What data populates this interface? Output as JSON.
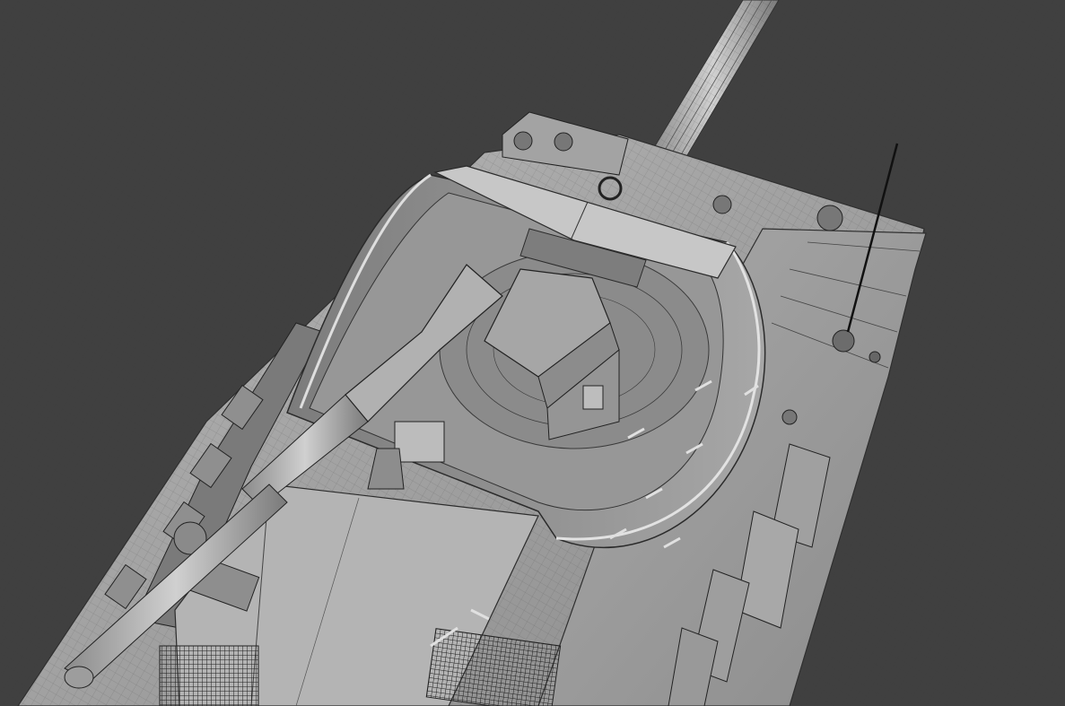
{
  "scene": {
    "subject": "tank-wireframe-render",
    "background_color": "#404040",
    "hull_color": "#9a9a9a",
    "hull_shadow_color": "#6e6e6e",
    "hull_highlight_color": "#c9c9c9",
    "wire_color": "#2e2e2e"
  }
}
